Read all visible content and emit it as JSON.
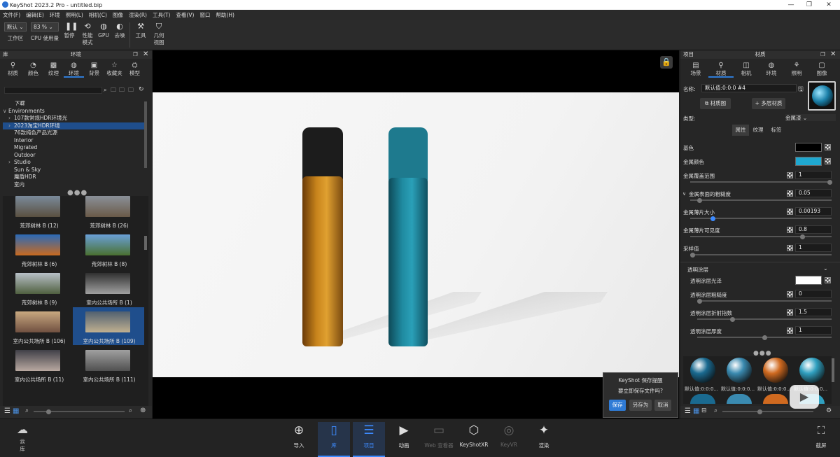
{
  "window": {
    "title": "KeyShot 2023.2 Pro  - untitled.bip"
  },
  "menu": [
    "文件(F)",
    "编辑(E)",
    "环境",
    "照明(L)",
    "相机(C)",
    "图像",
    "渲染(R)",
    "工具(T)",
    "查看(V)",
    "窗口",
    "帮助(H)"
  ],
  "toolbar": {
    "workspace_value": "默认",
    "workspace_label": "工作区",
    "cpu_value": "83 %",
    "cpu_label": "CPU 使用量",
    "pause": "暂停",
    "perf1": "性能",
    "perf2": "模式",
    "gpu": "GPU",
    "denoise": "去噪",
    "tools": "工具",
    "geo1": "几何",
    "geo2": "视图"
  },
  "library": {
    "side_label": "库",
    "title": "环境",
    "tabs": [
      "材质",
      "颜色",
      "纹理",
      "环境",
      "背景",
      "收藏夹",
      "模型"
    ],
    "active_tab": 3,
    "tree": [
      {
        "label": "下载",
        "indent": 1,
        "arrow": "",
        "selected": false,
        "italic": true
      },
      {
        "label": "Environments",
        "indent": 0,
        "arrow": "∨",
        "selected": false
      },
      {
        "label": "107款常规HDR环境光",
        "indent": 1,
        "arrow": "›",
        "selected": false
      },
      {
        "label": "2023淘宝HDR环境",
        "indent": 1,
        "arrow": "›",
        "selected": true
      },
      {
        "label": "76款纯色产品光源",
        "indent": 1,
        "arrow": "",
        "selected": false
      },
      {
        "label": "Interior",
        "indent": 1,
        "arrow": "",
        "selected": false
      },
      {
        "label": "Migrated",
        "indent": 1,
        "arrow": "",
        "selected": false
      },
      {
        "label": "Outdoor",
        "indent": 1,
        "arrow": "",
        "selected": false
      },
      {
        "label": "Studio",
        "indent": 1,
        "arrow": "›",
        "selected": false
      },
      {
        "label": "Sun & Sky",
        "indent": 1,
        "arrow": "",
        "selected": false
      },
      {
        "label": "魔盾HDR",
        "indent": 1,
        "arrow": "",
        "selected": false
      },
      {
        "label": "室内",
        "indent": 1,
        "arrow": "",
        "selected": false
      }
    ],
    "thumbs": [
      {
        "label": "荒郊树林 B (12)",
        "c1": "#7a8a9a",
        "c2": "#5a5040",
        "selected": false
      },
      {
        "label": "荒郊树林 B (26)",
        "c1": "#8a9098",
        "c2": "#6a5a48",
        "selected": false
      },
      {
        "label": "荒郊树林 B (6)",
        "c1": "#2a6ab8",
        "c2": "#c86a20",
        "selected": false
      },
      {
        "label": "荒郊树林 B (8)",
        "c1": "#6aa0d8",
        "c2": "#4a7030",
        "selected": false
      },
      {
        "label": "荒郊树林 B (9)",
        "c1": "#b8c0c8",
        "c2": "#506040",
        "selected": false
      },
      {
        "label": "室内公共场所 B (1)",
        "c1": "#303030",
        "c2": "#a0a0a0",
        "selected": false
      },
      {
        "label": "室内公共场所 B (106)",
        "c1": "#c8a880",
        "c2": "#705040",
        "selected": false
      },
      {
        "label": "室内公共场所 B (109)",
        "c1": "#506070",
        "c2": "#c0b090",
        "selected": true
      },
      {
        "label": "室内公共场所 B (11)",
        "c1": "#404048",
        "c2": "#b8a8a0",
        "selected": false
      },
      {
        "label": "室内公共场所 B (111)",
        "c1": "#a0a0a0",
        "c2": "#505050",
        "selected": false
      }
    ]
  },
  "project": {
    "side_label": "项目",
    "title": "材质",
    "tabs": [
      "场景",
      "材质",
      "相机",
      "环境",
      "照明",
      "图像"
    ],
    "active_tab": 1,
    "name_label": "名称:",
    "name_value": "默认值:0:0:0 #4",
    "btn_material_graph": "材质图",
    "btn_multi_material": "多层材质",
    "type_label": "类型:",
    "type_value": "金属漆",
    "subtabs": [
      "属性",
      "纹理",
      "标签"
    ],
    "props": [
      {
        "label": "基色",
        "kind": "color",
        "color": "#000000"
      },
      {
        "label": "金属颜色",
        "kind": "color",
        "color": "#1fa8d0"
      },
      {
        "label": "金属覆盖范围",
        "kind": "value",
        "value": "1",
        "slider": 1.0
      },
      {
        "label": "金属表面的粗糙度",
        "kind": "value",
        "value": "0.05",
        "slider": 0.05,
        "expander": true
      },
      {
        "label": "金属薄片大小",
        "kind": "value",
        "value": "0.00193",
        "slider": 0.15,
        "active": true
      },
      {
        "label": "金属薄片可见度",
        "kind": "value",
        "value": "0.8",
        "slider": 0.8
      },
      {
        "label": "采样值",
        "kind": "value",
        "value": "1",
        "slider": 0.0
      }
    ],
    "clearcoat_title": "透明涂层",
    "clearcoat": [
      {
        "label": "透明涂层光泽",
        "kind": "color",
        "color": "#ffffff"
      },
      {
        "label": "透明涂层粗糙度",
        "kind": "value",
        "value": "0",
        "slider": 0.0
      },
      {
        "label": "透明涂层折射指数",
        "kind": "value",
        "value": "1.5",
        "slider": 0.25
      },
      {
        "label": "透明涂层厚度",
        "kind": "value",
        "value": "1",
        "slider": 0.5
      }
    ],
    "balls": [
      {
        "label": "默认值:0:0:0...",
        "c": "#1a6a90"
      },
      {
        "label": "默认值:0:0:0...",
        "c": "#3a8ab0"
      },
      {
        "label": "默认值:0:0:0...",
        "c": "#d06a20"
      },
      {
        "label": "默认值:0:0:0...",
        "c": "#30a0c0"
      }
    ]
  },
  "dialog": {
    "title": "KeyShot 保存提醒",
    "message": "要立即保存文件吗?",
    "save": "保存",
    "save_as": "另存为",
    "cancel": "取消"
  },
  "bottom": {
    "cloud1": "云",
    "cloud2": "库",
    "items": [
      {
        "label": "导入",
        "icon": "⊕",
        "active": false,
        "dim": false
      },
      {
        "label": "库",
        "icon": "▯",
        "active": true,
        "dim": false
      },
      {
        "label": "项目",
        "icon": "☰",
        "active": true,
        "dim": false
      },
      {
        "label": "动画",
        "icon": "▶",
        "active": false,
        "dim": false
      },
      {
        "label": "Web 查看器",
        "icon": "▭",
        "active": false,
        "dim": true
      },
      {
        "label": "KeyShotXR",
        "icon": "⬡",
        "active": false,
        "dim": false
      },
      {
        "label": "KeyVR",
        "icon": "◎",
        "active": false,
        "dim": true
      },
      {
        "label": "渲染",
        "icon": "✦",
        "active": false,
        "dim": false
      }
    ],
    "screenshot": "截屏"
  }
}
